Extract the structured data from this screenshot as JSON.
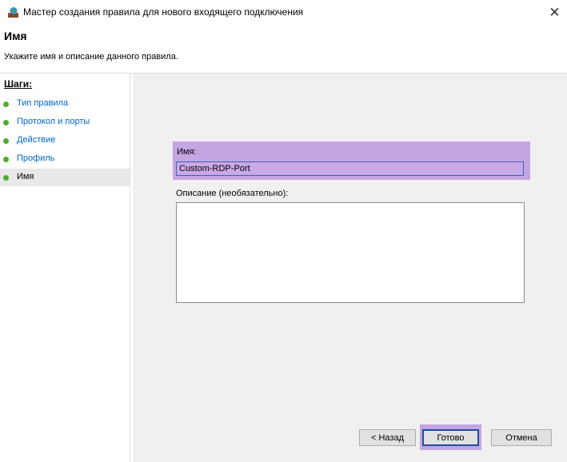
{
  "window": {
    "title": "Мастер создания правила для нового входящего подключения",
    "close_glyph": "✕"
  },
  "header": {
    "title": "Имя",
    "description": "Укажите имя и описание данного правила."
  },
  "sidebar": {
    "steps_label": "Шаги:",
    "items": [
      {
        "label": "Тип правила",
        "status": "completed"
      },
      {
        "label": "Протокол и порты",
        "status": "completed"
      },
      {
        "label": "Действие",
        "status": "completed"
      },
      {
        "label": "Профиль",
        "status": "completed"
      },
      {
        "label": "Имя",
        "status": "current"
      }
    ]
  },
  "form": {
    "name_label": "Имя:",
    "name_value": "Custom-RDP-Port",
    "description_label": "Описание (необязательно):",
    "description_value": ""
  },
  "buttons": {
    "back": "< Назад",
    "finish": "Готово",
    "cancel": "Отмена"
  },
  "colors": {
    "step_dot": "#4cae2a",
    "link": "#0066cc",
    "highlight": "#c6a5e3",
    "focus_border": "#1a4fa0"
  }
}
